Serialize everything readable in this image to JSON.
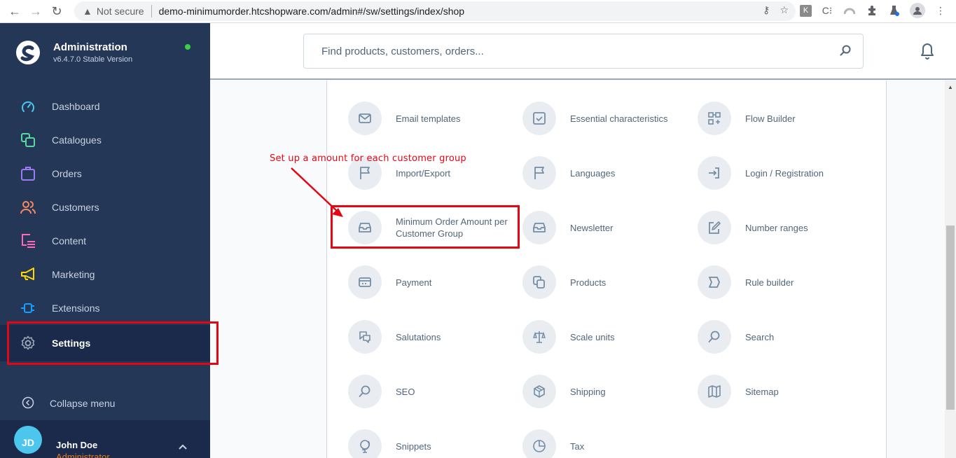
{
  "browser": {
    "security_label": "Not secure",
    "url": "demo-minimumorder.htcshopware.com/admin#/sw/settings/index/shop",
    "extension_k": "K",
    "extension_c": "C⁝"
  },
  "sidebar": {
    "brand_title": "Administration",
    "brand_version": "v6.4.7.0 Stable Version",
    "status_color": "#37d046",
    "items": [
      {
        "label": "Dashboard",
        "icon": "dashboard-icon",
        "color": "#4dc6ee"
      },
      {
        "label": "Catalogues",
        "icon": "catalogues-icon",
        "color": "#57d9a3"
      },
      {
        "label": "Orders",
        "icon": "orders-icon",
        "color": "#9f78f5"
      },
      {
        "label": "Customers",
        "icon": "customers-icon",
        "color": "#f88962"
      },
      {
        "label": "Content",
        "icon": "content-icon",
        "color": "#ff68b4"
      },
      {
        "label": "Marketing",
        "icon": "marketing-icon",
        "color": "#ffd700"
      },
      {
        "label": "Extensions",
        "icon": "extensions-icon",
        "color": "#189eff"
      },
      {
        "label": "Settings",
        "icon": "settings-icon",
        "color": "#9aa8b5",
        "active": true
      }
    ],
    "collapse_label": "Collapse menu",
    "user": {
      "initials": "JD",
      "name": "John Doe",
      "role": "Administrator"
    }
  },
  "header": {
    "search_placeholder": "Find products, customers, orders..."
  },
  "annotation": {
    "text": "Set up a amount for each customer group",
    "color": "#e30613"
  },
  "settings": {
    "items": [
      {
        "label": "Email templates",
        "icon": "envelope-icon"
      },
      {
        "label": "Essential characteristics",
        "icon": "checkbox-icon"
      },
      {
        "label": "Flow Builder",
        "icon": "flow-builder-icon"
      },
      {
        "label": "Import/Export",
        "icon": "flag-icon"
      },
      {
        "label": "Languages",
        "icon": "flag-icon"
      },
      {
        "label": "Login / Registration",
        "icon": "sign-in-icon"
      },
      {
        "label": "Minimum Order Amount per Customer Group",
        "icon": "inbox-icon",
        "highlighted": true
      },
      {
        "label": "Newsletter",
        "icon": "inbox-icon"
      },
      {
        "label": "Number ranges",
        "icon": "edit-icon"
      },
      {
        "label": "Payment",
        "icon": "credit-card-icon"
      },
      {
        "label": "Products",
        "icon": "products-icon"
      },
      {
        "label": "Rule builder",
        "icon": "rule-icon"
      },
      {
        "label": "Salutations",
        "icon": "chat-icon"
      },
      {
        "label": "Scale units",
        "icon": "scale-icon"
      },
      {
        "label": "Search",
        "icon": "search-icon"
      },
      {
        "label": "SEO",
        "icon": "search-icon"
      },
      {
        "label": "Shipping",
        "icon": "package-icon"
      },
      {
        "label": "Sitemap",
        "icon": "map-icon"
      },
      {
        "label": "Snippets",
        "icon": "globe-icon"
      },
      {
        "label": "Tax",
        "icon": "pie-chart-icon"
      }
    ]
  }
}
